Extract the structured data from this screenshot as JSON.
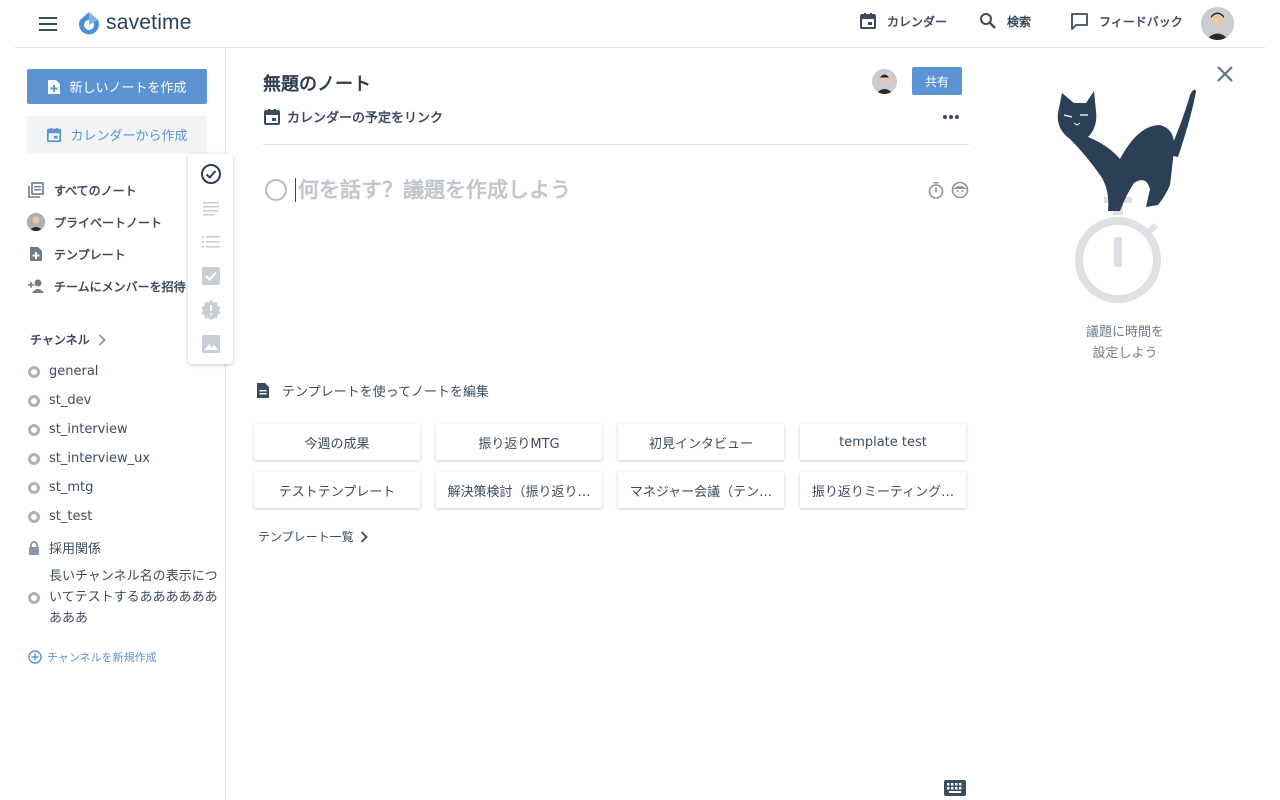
{
  "app": {
    "name": "savetime"
  },
  "header": {
    "nav": [
      {
        "label": "カレンダー",
        "icon": "calendar-icon"
      },
      {
        "label": "検索",
        "icon": "search-icon"
      },
      {
        "label": "フィードバック",
        "icon": "feedback-icon"
      }
    ]
  },
  "sidebar": {
    "new_note_label": "新しいノートを作成",
    "from_calendar_label": "カレンダーから作成",
    "items": [
      {
        "label": "すべてのノート",
        "icon": "notes-icon"
      },
      {
        "label": "プライベートノート",
        "icon": "avatar"
      },
      {
        "label": "テンプレート",
        "icon": "template-icon"
      },
      {
        "label": "チームにメンバーを招待",
        "icon": "add-person-icon"
      }
    ],
    "channels_heading": "チャンネル",
    "channels": [
      {
        "name": "general",
        "type": "public"
      },
      {
        "name": "st_dev",
        "type": "public"
      },
      {
        "name": "st_interview",
        "type": "public"
      },
      {
        "name": "st_interview_ux",
        "type": "public"
      },
      {
        "name": "st_mtg",
        "type": "public"
      },
      {
        "name": "st_test",
        "type": "public"
      },
      {
        "name": "採用関係",
        "type": "private"
      }
    ],
    "long_channel": "長いチャンネル名の表示についてテストするあああああああああ",
    "new_channel_label": "チャンネルを新規作成"
  },
  "floating_tools": [
    "agenda-check-icon",
    "paragraph-icon",
    "list-icon",
    "checkbox-icon",
    "alert-icon",
    "image-icon"
  ],
  "note": {
    "title": "無題のノート",
    "share_label": "共有",
    "calendar_link": "カレンダーの予定をリンク",
    "agenda_placeholder": "何を話す？議題を作成しよう"
  },
  "templates": {
    "label": "テンプレートを使ってノートを編集",
    "items": [
      "今週の成果",
      "振り返りMTG",
      "初見インタビュー",
      "template test",
      "テストテンプレート",
      "解決策検討（振り返り…",
      "マネジャー会議（テン…",
      "振り返りミーティング…"
    ],
    "more_label": "テンプレート一覧"
  },
  "right_panel": {
    "hint_line1": "議題に時間を",
    "hint_line2": "設定しよう"
  },
  "colors": {
    "primary": "#5b93d3",
    "text": "#3b4c5e",
    "muted": "#aab2bb",
    "cat": "#2b3f56"
  }
}
